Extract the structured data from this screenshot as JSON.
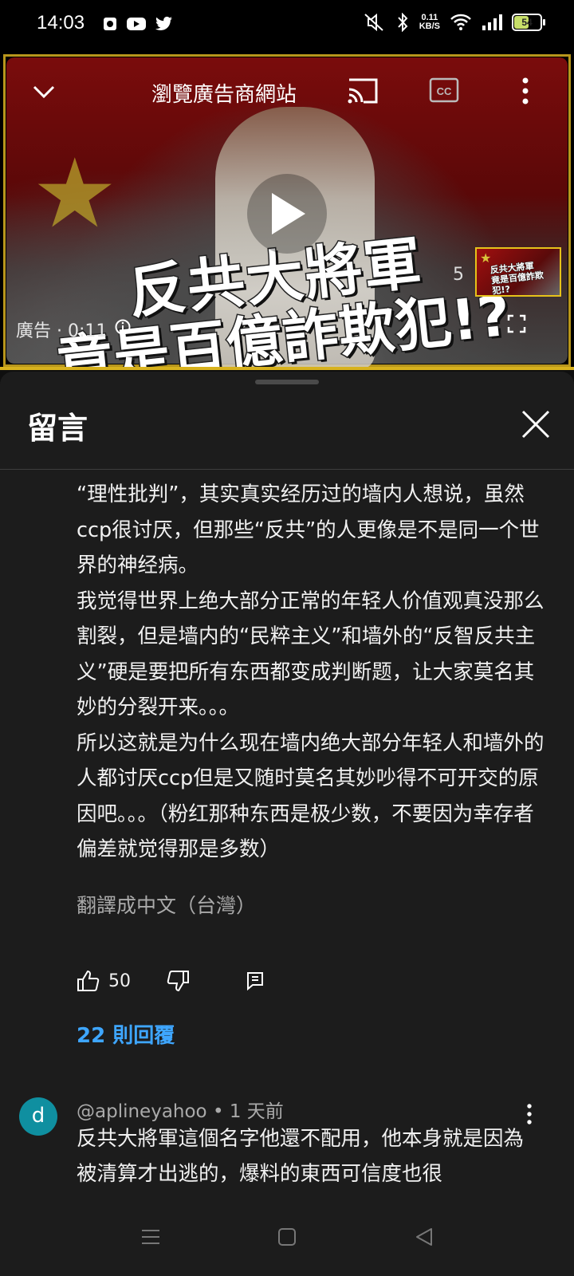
{
  "status_bar": {
    "time": "14:03",
    "net_speed_value": "0.11",
    "net_speed_unit": "KB/S",
    "battery": "54"
  },
  "video": {
    "ad_site_link": "瀏覽廣告商網站",
    "headline_line1": "反共大將軍",
    "headline_line2": "竟是百億詐欺犯!?",
    "skip_countdown": "5",
    "ad_label": "廣告 · 0:11",
    "thumb_line1": "反共大將軍",
    "thumb_line2": "竟是百億詐欺犯!?",
    "progress_fraction": 1.0
  },
  "sheet": {
    "title": "留言"
  },
  "comment": {
    "paragraphs": [
      "“理性批判”，其实真实经历过的墙内人想说，虽然ccp很讨厌，但那些“反共”的人更像是不是同一个世界的神经病。",
      "我觉得世界上绝大部分正常的年轻人价值观真没那么割裂，但是墙内的“民粹主义”和墙外的“反智反共主义”硬是要把所有东西都变成判断题，让大家莫名其妙的分裂开来。。。",
      "所以这就是为什么现在墙内绝大部分年轻人和墙外的人都讨厌ccp但是又随时莫名其妙吵得不可开交的原因吧。。。（粉红那种东西是极少数，不要因为幸存者偏差就觉得那是多数）"
    ],
    "translate": "翻譯成中文（台灣）",
    "like_count": "50",
    "replies": "22 則回覆"
  },
  "next_comment": {
    "avatar_letter": "d",
    "meta": "@aplineyahoo • 1 天前",
    "text": "反共大將軍這個名字他還不配用，他本身就是因為被清算才出逃的，爆料的東西可信度也很"
  }
}
